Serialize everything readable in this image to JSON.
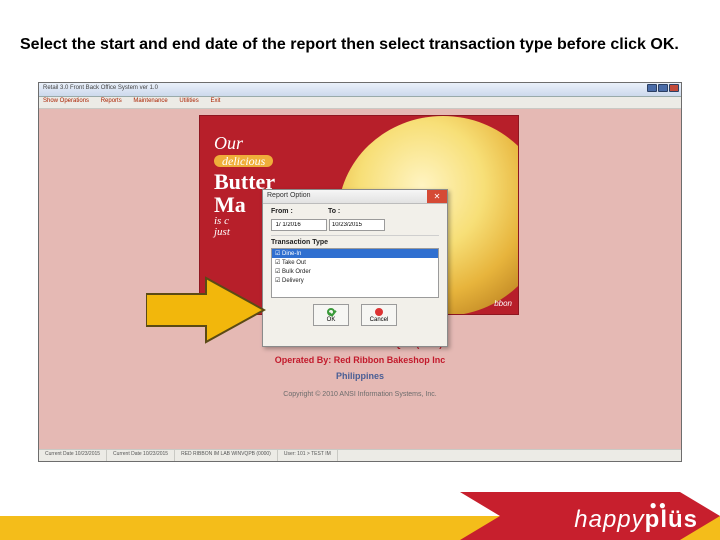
{
  "instruction": "Select the start and end date of the report then select transaction type before click OK.",
  "window": {
    "title": "Retail 3.0 Front Back Office System  ver 1.0",
    "menu": [
      "Show Operations",
      "Reports",
      "Maintenance",
      "Utilities",
      "Exit"
    ]
  },
  "poster": {
    "line1": "Our",
    "badge": "delicious",
    "line2": "Butter",
    "line3": "Ma",
    "line4": "is c",
    "line5": "just",
    "brand": "bbon"
  },
  "info": {
    "store": "RED RIBBON IM LAB WINVQPB (0000)",
    "operated": "Operated By: Red Ribbon Bakeshop Inc",
    "country": "Philippines",
    "copyright": "Copyright © 2010 ANSI Information Systems, Inc."
  },
  "status": {
    "s1": "Current Date 10/23/2015",
    "s2": "Current Date 10/23/2015",
    "s3": "RED RIBBON IM LAB WINVQPB (0000)",
    "s4": "User: 101 > TEST IM"
  },
  "dialog": {
    "title": "Report Option",
    "from_label": "From :",
    "to_label": "To :",
    "from_value": " 1/ 1/2016",
    "to_value": "10/23/2015",
    "trans_label": "Transaction Type",
    "types": [
      "Dine-In",
      "Take Out",
      "Bulk Order",
      "Delivery"
    ],
    "ok_label": "OK",
    "cancel_label": "Cancel"
  },
  "footerbrand": {
    "a": "happy",
    "b": "plüs"
  }
}
